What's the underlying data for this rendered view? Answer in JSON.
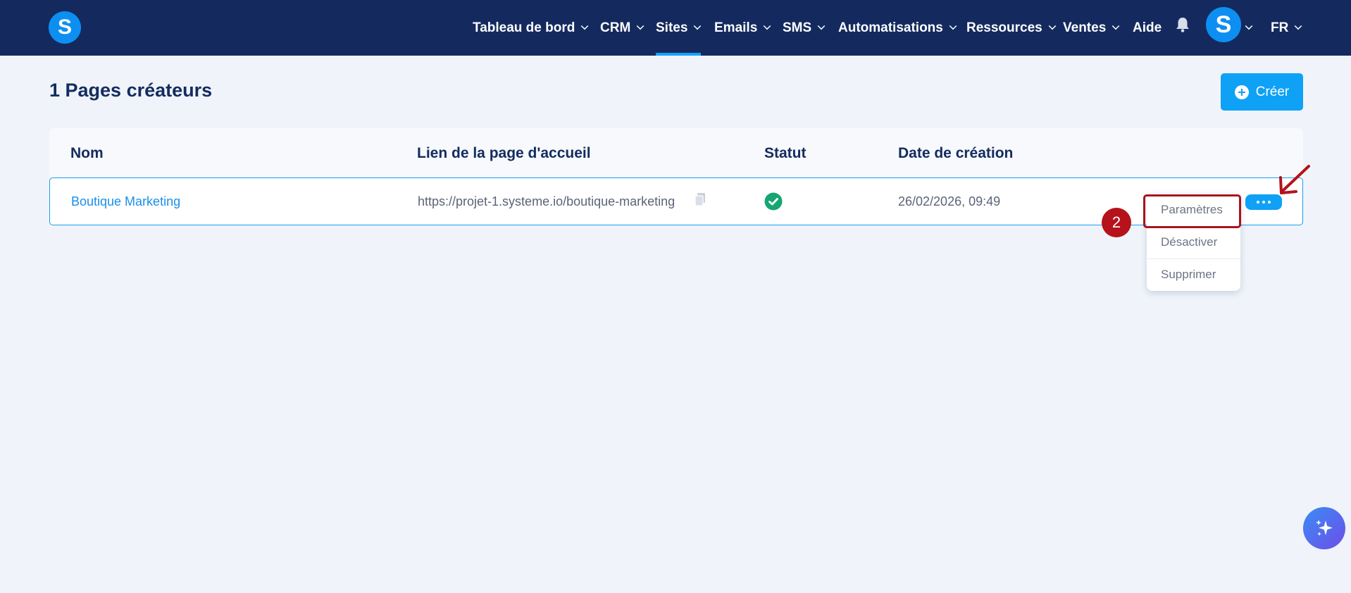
{
  "nav": {
    "logo": "S",
    "items": [
      {
        "label": "Tableau de bord",
        "dropdown": true
      },
      {
        "label": "CRM",
        "dropdown": true
      },
      {
        "label": "Sites",
        "dropdown": true,
        "active": true
      },
      {
        "label": "Emails",
        "dropdown": true
      },
      {
        "label": "SMS",
        "dropdown": true
      },
      {
        "label": "Automatisations",
        "dropdown": true
      },
      {
        "label": "Ressources",
        "dropdown": true
      },
      {
        "label": "Ventes",
        "dropdown": true
      },
      {
        "label": "Aide",
        "dropdown": false
      }
    ],
    "avatar": "S",
    "language": "FR"
  },
  "page": {
    "title": "1 Pages créateurs",
    "create_label": "Créer"
  },
  "table": {
    "headers": [
      "Nom",
      "Lien de la page d'accueil",
      "Statut",
      "Date de création"
    ],
    "rows": [
      {
        "name": "Boutique Marketing",
        "url": "https://projet-1.systeme.io/boutique-marketing",
        "status": "active",
        "created": "26/02/2026, 09:49"
      }
    ]
  },
  "menu": {
    "items": [
      "Paramètres",
      "Désactiver",
      "Supprimer"
    ]
  },
  "annotation": {
    "step": "2"
  },
  "colors": {
    "nav_bg": "#142a5f",
    "accent": "#0ea1f6",
    "status_ok": "#17a673",
    "annotation_red": "#b5121b"
  },
  "icons": [
    "logo-icon",
    "chevron-down-icon",
    "bell-icon",
    "plus-circle-icon",
    "copy-icon",
    "check-circle-icon",
    "more-dots-icon",
    "sparkle-icon"
  ]
}
